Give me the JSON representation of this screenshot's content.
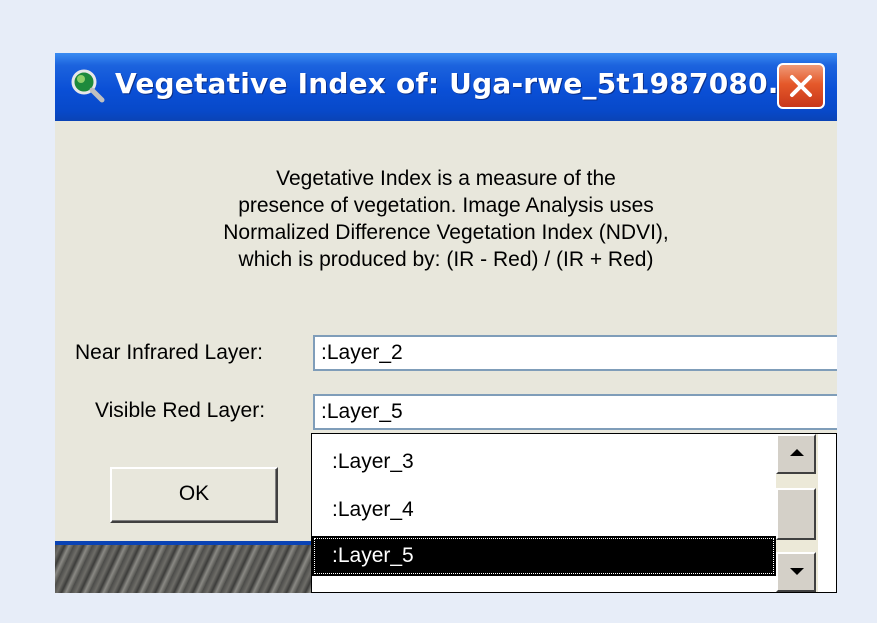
{
  "window": {
    "title": "Vegetative Index of: Uga-rwe_5t1987080...",
    "title_icon": "magnifier-icon",
    "close_icon": "close-icon"
  },
  "description": {
    "lines": [
      "Vegetative Index is a measure of the",
      "presence of vegetation.  Image Analysis uses",
      "Normalized Difference Vegetation Index (NDVI),",
      "which is produced by:  (IR - Red) / (IR + Red)"
    ]
  },
  "form": {
    "nir_label": "Near Infrared Layer:",
    "nir_value": ":Layer_2",
    "red_label": "Visible Red Layer:",
    "red_value": ":Layer_5"
  },
  "ok_label": "OK",
  "dropdown": {
    "options": [
      ":Layer_3",
      ":Layer_4",
      ":Layer_5"
    ],
    "selected": ":Layer_5"
  },
  "colors": {
    "title_bar": "#0a4fd6",
    "dialog_bg": "#e8e7dc",
    "close_button": "#e5592a",
    "selection": "#000000",
    "page_bg": "#e7edf8"
  }
}
